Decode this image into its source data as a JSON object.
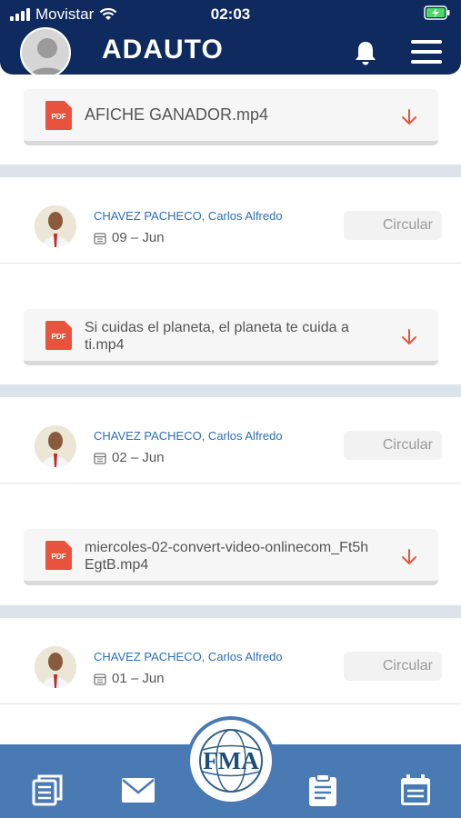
{
  "status_bar": {
    "carrier": "Movistar",
    "time": "02:03"
  },
  "header": {
    "title": "ADAUTO"
  },
  "posts": [
    {
      "file_name": "AFICHE GANADOR.mp4",
      "file_type_label": "PDF"
    },
    {
      "author": "CHAVEZ PACHECO, Carlos Alfredo",
      "date": "09 – Jun",
      "action_label": "Circular",
      "file_name": "Si cuidas el planeta, el planeta te cuida a ti.mp4",
      "file_type_label": "PDF"
    },
    {
      "author": "CHAVEZ PACHECO, Carlos Alfredo",
      "date": "02 – Jun",
      "action_label": "Circular",
      "file_name": "miercoles-02-convert-video-onlinecom_Ft5hEgtB.mp4",
      "file_type_label": "PDF"
    },
    {
      "author": "CHAVEZ PACHECO, Carlos Alfredo",
      "date": "01 – Jun",
      "action_label": "Circular"
    }
  ],
  "bottom_nav": {
    "logo_text": "FMA",
    "items": [
      "news-icon",
      "mail-icon",
      "clipboard-icon",
      "calendar-icon"
    ]
  },
  "colors": {
    "header_bg": "#0e2a5e",
    "nav_bg": "#4a7ab4",
    "author_link": "#2d6fb5",
    "pdf_red": "#e8533e",
    "separator": "#dde3ea"
  }
}
